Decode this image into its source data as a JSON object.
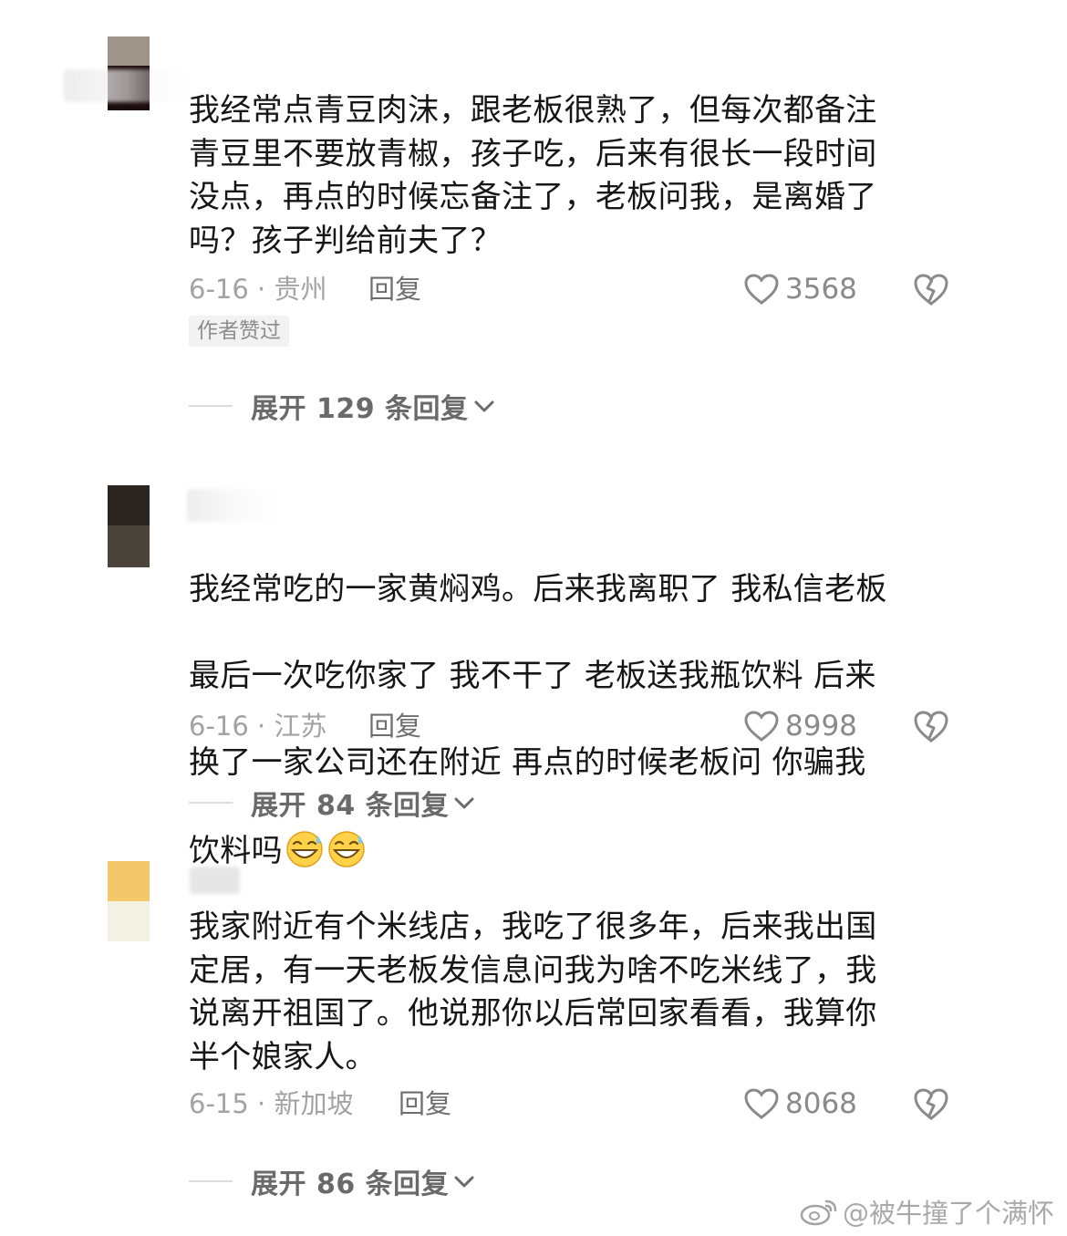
{
  "comments": [
    {
      "text": "我经常点青豆肉沫，跟老板很熟了，但每次都备注\n青豆里不要放青椒，孩子吃，后来有很长一段时间\n没点，再点的时候忘备注了，老板问我，是离婚了\n吗？孩子判给前夫了？",
      "date_location": "6-16 · 贵州",
      "reply_label": "回复",
      "likes": "3568",
      "badge": "作者赞过",
      "expand_label": "展开 129 条回复",
      "avatar_colors": [
        "#9e9488",
        "#1c0d0d"
      ]
    },
    {
      "text_lines": [
        "我经常吃的一家黄焖鸡。后来我离职了 我私信老板",
        "最后一次吃你家了 我不干了 老板送我瓶饮料 后来",
        "换了一家公司还在附近 再点的时候老板问 你骗我",
        "饮料吗"
      ],
      "emojis": [
        "grinning-sweat-emoji",
        "grinning-sweat-emoji"
      ],
      "date_location": "6-16 · 江苏",
      "reply_label": "回复",
      "likes": "8998",
      "expand_label": "展开 84 条回复",
      "avatar_colors": [
        "#2a2520",
        "#4a433c"
      ]
    },
    {
      "text": "我家附近有个米线店，我吃了很多年，后来我出国\n定居，有一天老板发信息问我为啥不吃米线了，我\n说离开祖国了。他说那你以后常回家看看，我算你\n半个娘家人。",
      "date_location": "6-15 · 新加坡",
      "reply_label": "回复",
      "likes": "8068",
      "expand_label": "展开 86 条回复",
      "avatar_colors": [
        "#f4c76a",
        "#f3f1e2"
      ]
    }
  ],
  "watermark": "@被牛撞了个满怀",
  "icons": {
    "like": "heart-outline-icon",
    "dislike": "broken-heart-icon",
    "expand": "chevron-down-icon",
    "watermark": "weibo-logo-icon"
  }
}
